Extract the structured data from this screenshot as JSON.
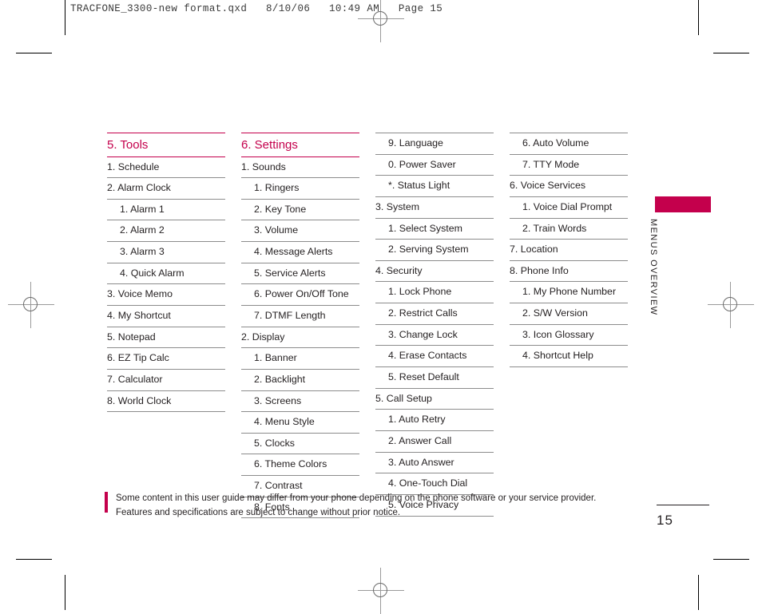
{
  "file_header": "TRACFONE_3300-new format.qxd   8/10/06   10:49 AM   Page 15",
  "side_tab": {
    "label": "MENUS OVERVIEW",
    "accent_color": "#c4004c"
  },
  "page_number": "15",
  "theme": {
    "accent": "#c4004c",
    "rule": "#8c8c8c",
    "text": "#231f20"
  },
  "footnote": {
    "line1": "Some content in this user guide may differ from your phone depending on the phone software or your service provider.",
    "line2": "Features and specifications are subject to change without prior notice."
  },
  "columns": [
    {
      "heading": "5. Tools",
      "has_heading": true,
      "items": [
        {
          "label": "1. Schedule",
          "level": 1
        },
        {
          "label": "2. Alarm Clock",
          "level": 1
        },
        {
          "label": "1. Alarm 1",
          "level": 2
        },
        {
          "label": "2. Alarm 2",
          "level": 2
        },
        {
          "label": "3. Alarm 3",
          "level": 2
        },
        {
          "label": "4. Quick Alarm",
          "level": 2
        },
        {
          "label": "3. Voice Memo",
          "level": 1
        },
        {
          "label": "4. My Shortcut",
          "level": 1
        },
        {
          "label": "5. Notepad",
          "level": 1
        },
        {
          "label": "6. EZ Tip Calc",
          "level": 1
        },
        {
          "label": "7. Calculator",
          "level": 1
        },
        {
          "label": "8. World Clock",
          "level": 1
        }
      ]
    },
    {
      "heading": "6. Settings",
      "has_heading": true,
      "items": [
        {
          "label": "1. Sounds",
          "level": 1
        },
        {
          "label": "1. Ringers",
          "level": 2
        },
        {
          "label": "2. Key Tone",
          "level": 2
        },
        {
          "label": "3. Volume",
          "level": 2
        },
        {
          "label": "4. Message Alerts",
          "level": 2
        },
        {
          "label": "5. Service Alerts",
          "level": 2
        },
        {
          "label": "6. Power On/Off Tone",
          "level": 2
        },
        {
          "label": "7. DTMF Length",
          "level": 2
        },
        {
          "label": "2. Display",
          "level": 1
        },
        {
          "label": "1. Banner",
          "level": 2
        },
        {
          "label": "2. Backlight",
          "level": 2
        },
        {
          "label": "3. Screens",
          "level": 2
        },
        {
          "label": "4. Menu Style",
          "level": 2
        },
        {
          "label": "5. Clocks",
          "level": 2
        },
        {
          "label": "6. Theme Colors",
          "level": 2
        },
        {
          "label": "7. Contrast",
          "level": 2
        },
        {
          "label": "8. Fonts",
          "level": 2
        }
      ]
    },
    {
      "heading": "",
      "has_heading": false,
      "items": [
        {
          "label": "9. Language",
          "level": 2
        },
        {
          "label": "0. Power Saver",
          "level": 2
        },
        {
          "label": "*. Status Light",
          "level": 2
        },
        {
          "label": "3. System",
          "level": 1
        },
        {
          "label": "1. Select System",
          "level": 2
        },
        {
          "label": "2. Serving System",
          "level": 2
        },
        {
          "label": "4. Security",
          "level": 1
        },
        {
          "label": "1. Lock Phone",
          "level": 2
        },
        {
          "label": "2. Restrict Calls",
          "level": 2
        },
        {
          "label": "3. Change Lock",
          "level": 2
        },
        {
          "label": "4. Erase Contacts",
          "level": 2
        },
        {
          "label": "5. Reset Default",
          "level": 2
        },
        {
          "label": "5. Call Setup",
          "level": 1
        },
        {
          "label": "1. Auto Retry",
          "level": 2
        },
        {
          "label": "2. Answer Call",
          "level": 2
        },
        {
          "label": "3. Auto Answer",
          "level": 2
        },
        {
          "label": "4. One-Touch Dial",
          "level": 2
        },
        {
          "label": "5. Voice Privacy",
          "level": 2
        }
      ]
    },
    {
      "heading": "",
      "has_heading": false,
      "items": [
        {
          "label": "6. Auto Volume",
          "level": 2
        },
        {
          "label": "7. TTY Mode",
          "level": 2
        },
        {
          "label": "6. Voice Services",
          "level": 1
        },
        {
          "label": "1. Voice Dial Prompt",
          "level": 2
        },
        {
          "label": "2. Train Words",
          "level": 2
        },
        {
          "label": "7. Location",
          "level": 1
        },
        {
          "label": "8. Phone Info",
          "level": 1
        },
        {
          "label": "1. My Phone Number",
          "level": 2
        },
        {
          "label": "2. S/W Version",
          "level": 2
        },
        {
          "label": "3. Icon Glossary",
          "level": 2
        },
        {
          "label": "4. Shortcut Help",
          "level": 2
        }
      ]
    }
  ]
}
